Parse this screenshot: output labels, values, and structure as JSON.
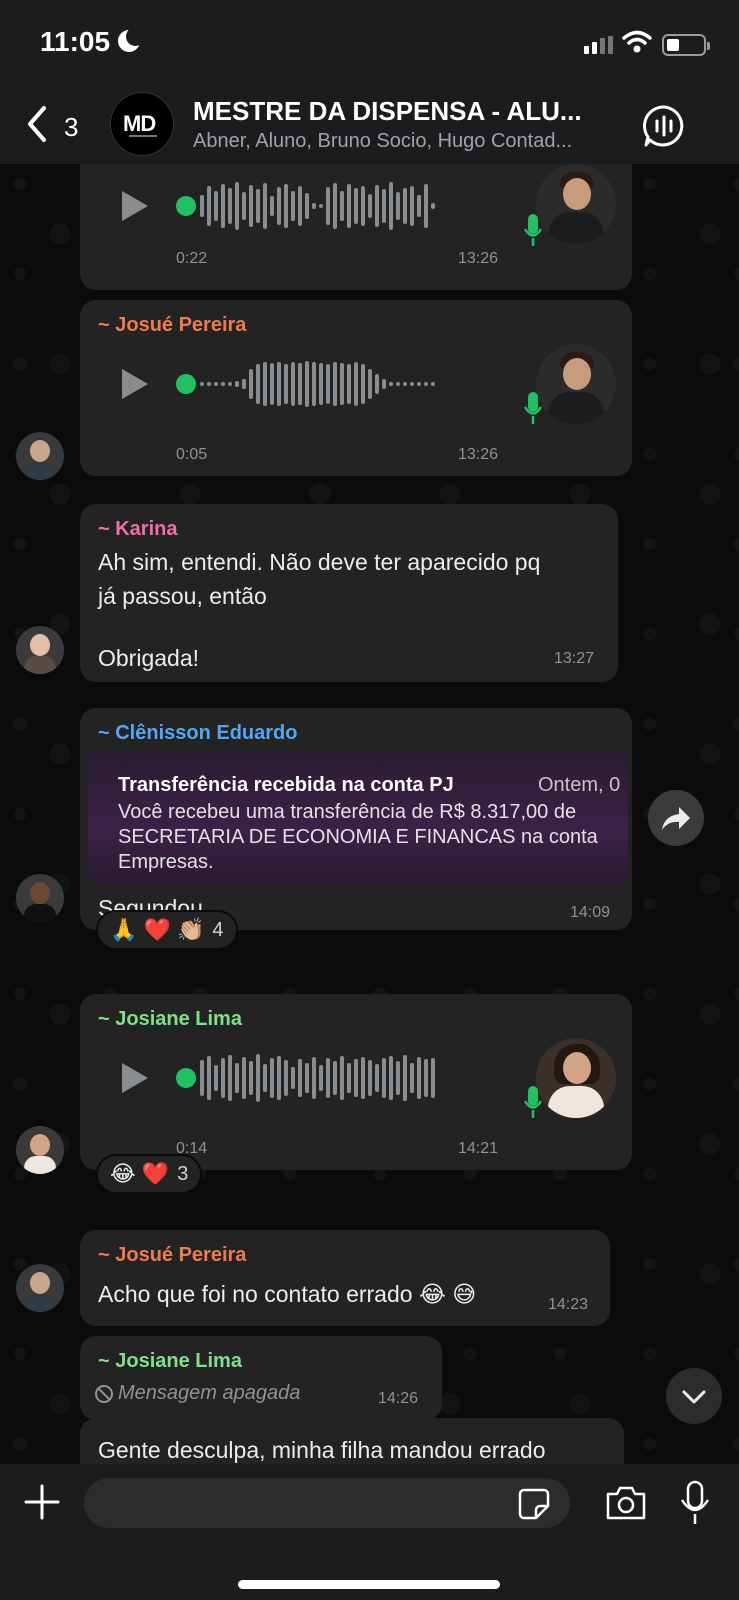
{
  "status": {
    "time": "11:05"
  },
  "header": {
    "back_count": "3",
    "logo_text": "MD",
    "title": "MESTRE DA DISPENSA - ALU...",
    "members": "Abner, Aluno, Bruno Socio, Hugo Contad..."
  },
  "messages": [
    {
      "type": "voice",
      "duration": "0:22",
      "time": "13:26"
    },
    {
      "type": "voice",
      "sender": "~ Josué Pereira",
      "duration": "0:05",
      "time": "13:26"
    },
    {
      "type": "text",
      "sender": "~ Karina",
      "line1": "Ah sim, entendi. Não deve ter aparecido pq",
      "line2": "já passou, então",
      "line3": "Obrigada!",
      "time": "13:27"
    },
    {
      "type": "image_text",
      "sender": "~ Clênisson Eduardo",
      "card_title": "Transferência recebida na conta PJ",
      "card_date": "Ontem, 0",
      "card_line1": "Você recebeu uma transferência de R$ 8.317,00 de",
      "card_line2": "SECRETARIA DE ECONOMIA E FINANCAS na conta",
      "card_line3": "Empresas.",
      "text": "Segundou",
      "time": "14:09",
      "reactions": "🙏 ❤️ 👏🏼",
      "reaction_count": "4"
    },
    {
      "type": "voice",
      "sender": "~ Josiane Lima",
      "duration": "0:14",
      "time": "14:21",
      "reactions": "😂 ❤️",
      "reaction_count": "3"
    },
    {
      "type": "text",
      "sender": "~ Josué Pereira",
      "text": "Acho que foi no contato errado 😂 😅",
      "time": "14:23"
    },
    {
      "type": "deleted",
      "sender": "~ Josiane Lima",
      "text": "Mensagem apagada",
      "time": "14:26"
    },
    {
      "type": "text",
      "text": "Gente desculpa, minha filha mandou errado"
    }
  ],
  "colors": {
    "josue": "#ee7a4d",
    "karina": "#f06ea9",
    "clenisson": "#53a6f5",
    "josiane": "#7fe08a",
    "accent_green": "#21c063"
  },
  "icons": [
    "back-chevron-icon",
    "voice-call-icon",
    "play-icon",
    "microphone-icon",
    "forward-icon",
    "chevron-down-icon",
    "plus-icon",
    "sticker-icon",
    "camera-icon",
    "blocked-icon"
  ]
}
